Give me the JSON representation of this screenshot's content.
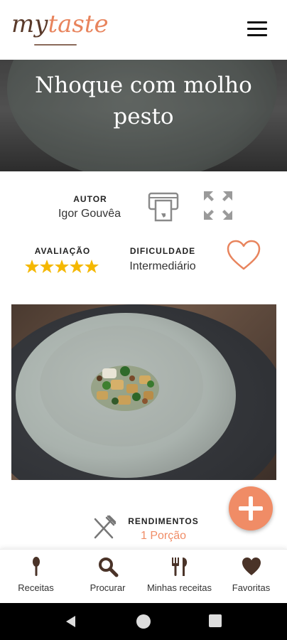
{
  "header": {
    "logo_my": "my",
    "logo_taste": "taste",
    "menu_icon": "hamburger-menu-icon"
  },
  "recipe": {
    "title": "Nhoque com molho pesto"
  },
  "author": {
    "label": "AUTOR",
    "name": "Igor Gouvêa"
  },
  "actions": {
    "print_icon": "print-icon",
    "expand_icon": "expand-icon",
    "favorite_icon": "heart-outline-icon"
  },
  "rating": {
    "label": "AVALIAÇÃO",
    "stars": 5,
    "max": 5,
    "color": "#f5b800"
  },
  "difficulty": {
    "label": "DIFICULDADE",
    "value": "Intermediário"
  },
  "yield": {
    "label": "RENDIMENTOS",
    "value": "1 Porção"
  },
  "fab": {
    "icon": "plus-icon",
    "color": "#f08c66"
  },
  "bottom_nav": {
    "items": [
      {
        "label": "Receitas",
        "icon": "spoon-icon"
      },
      {
        "label": "Procurar",
        "icon": "search-icon"
      },
      {
        "label": "Minhas receitas",
        "icon": "cutlery-icon"
      },
      {
        "label": "Favoritas",
        "icon": "heart-icon"
      }
    ]
  },
  "colors": {
    "accent": "#f08c66",
    "brand_dark": "#5a3a2a",
    "icon_gray": "#8a8a8a"
  }
}
